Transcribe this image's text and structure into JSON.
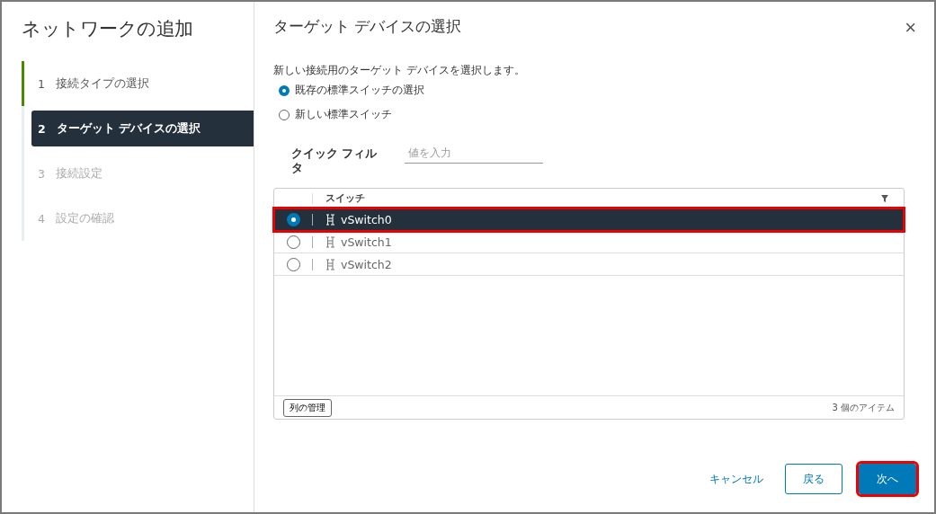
{
  "sidebar": {
    "title": "ネットワークの追加",
    "steps": [
      {
        "number": "1",
        "label": "接続タイプの選択",
        "completed": true,
        "disabled": false,
        "selected": false
      },
      {
        "number": "2",
        "label": "ターゲット デバイスの選択",
        "completed": false,
        "disabled": false,
        "selected": true
      },
      {
        "number": "3",
        "label": "接続設定",
        "completed": false,
        "disabled": true,
        "selected": false
      },
      {
        "number": "4",
        "label": "設定の確認",
        "completed": false,
        "disabled": true,
        "selected": false
      }
    ]
  },
  "dialog": {
    "title": "ターゲット デバイスの選択",
    "close": "×",
    "description": "新しい接続用のターゲット デバイスを選択します。",
    "options": [
      {
        "label": "既存の標準スイッチの選択",
        "selected": true
      },
      {
        "label": "新しい標準スイッチ",
        "selected": false
      }
    ],
    "filter": {
      "label": "クイック フィルタ",
      "placeholder": "値を入力"
    },
    "table": {
      "columns": [
        "スイッチ"
      ],
      "rows": [
        {
          "name": "vSwitch0",
          "selected": true,
          "highlighted": true
        },
        {
          "name": "vSwitch1",
          "selected": false,
          "highlighted": false
        },
        {
          "name": "vSwitch2",
          "selected": false,
          "highlighted": false
        }
      ],
      "manage_columns": "列の管理",
      "item_count": "3 個のアイテム"
    },
    "buttons": {
      "cancel": "キャンセル",
      "back": "戻る",
      "next": "次へ",
      "next_highlighted": true
    }
  }
}
